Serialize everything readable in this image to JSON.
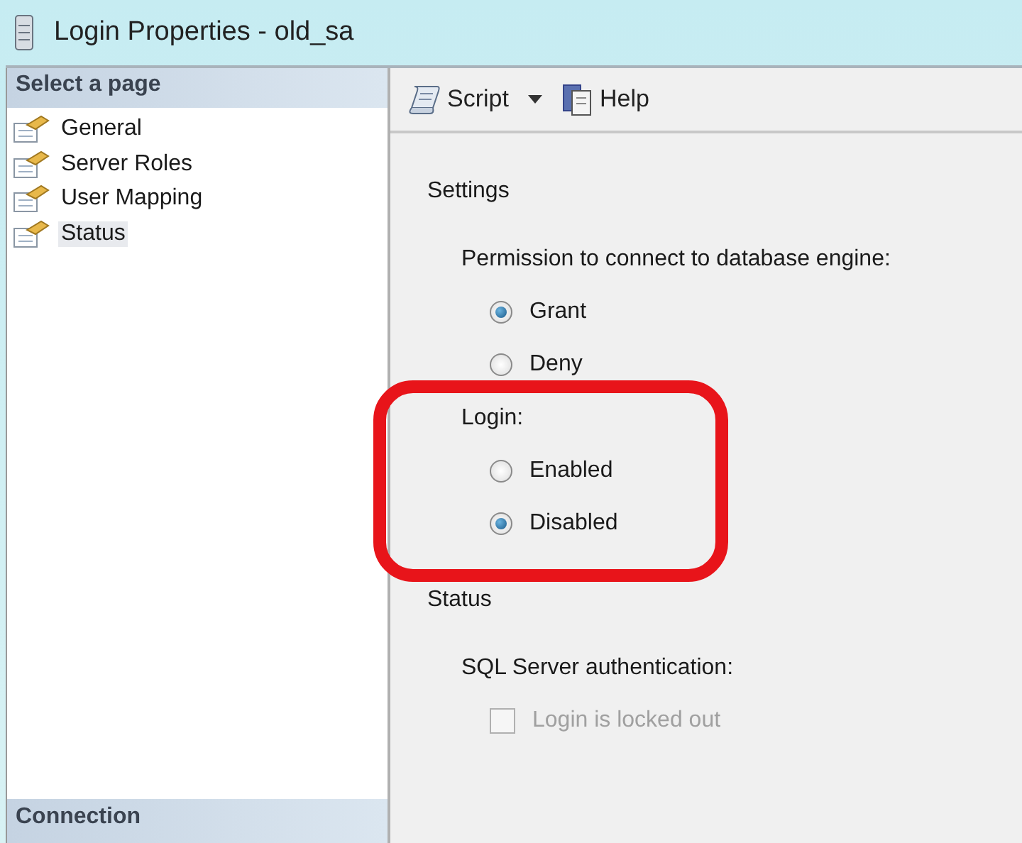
{
  "window": {
    "title": "Login Properties - old_sa"
  },
  "sidebar": {
    "header": "Select a page",
    "items": [
      {
        "label": "General",
        "selected": false
      },
      {
        "label": "Server Roles",
        "selected": false
      },
      {
        "label": "User Mapping",
        "selected": false
      },
      {
        "label": "Status",
        "selected": true
      }
    ],
    "footer": "Connection"
  },
  "toolbar": {
    "script": "Script",
    "help": "Help"
  },
  "sections": [
    {
      "title": "Settings",
      "groups": [
        {
          "label": "Permission to connect to database engine:",
          "highlighted": false,
          "options": [
            {
              "kind": "radio",
              "label": "Grant",
              "selected": true,
              "disabled": false
            },
            {
              "kind": "radio",
              "label": "Deny",
              "selected": false,
              "disabled": false
            }
          ]
        },
        {
          "label": "Login:",
          "highlighted": true,
          "options": [
            {
              "kind": "radio",
              "label": "Enabled",
              "selected": false,
              "disabled": false
            },
            {
              "kind": "radio",
              "label": "Disabled",
              "selected": true,
              "disabled": false
            }
          ]
        }
      ]
    },
    {
      "title": "Status",
      "groups": [
        {
          "label": "SQL Server authentication:",
          "highlighted": false,
          "options": [
            {
              "kind": "checkbox",
              "label": "Login is locked out",
              "checked": false,
              "disabled": true
            }
          ]
        }
      ]
    }
  ]
}
